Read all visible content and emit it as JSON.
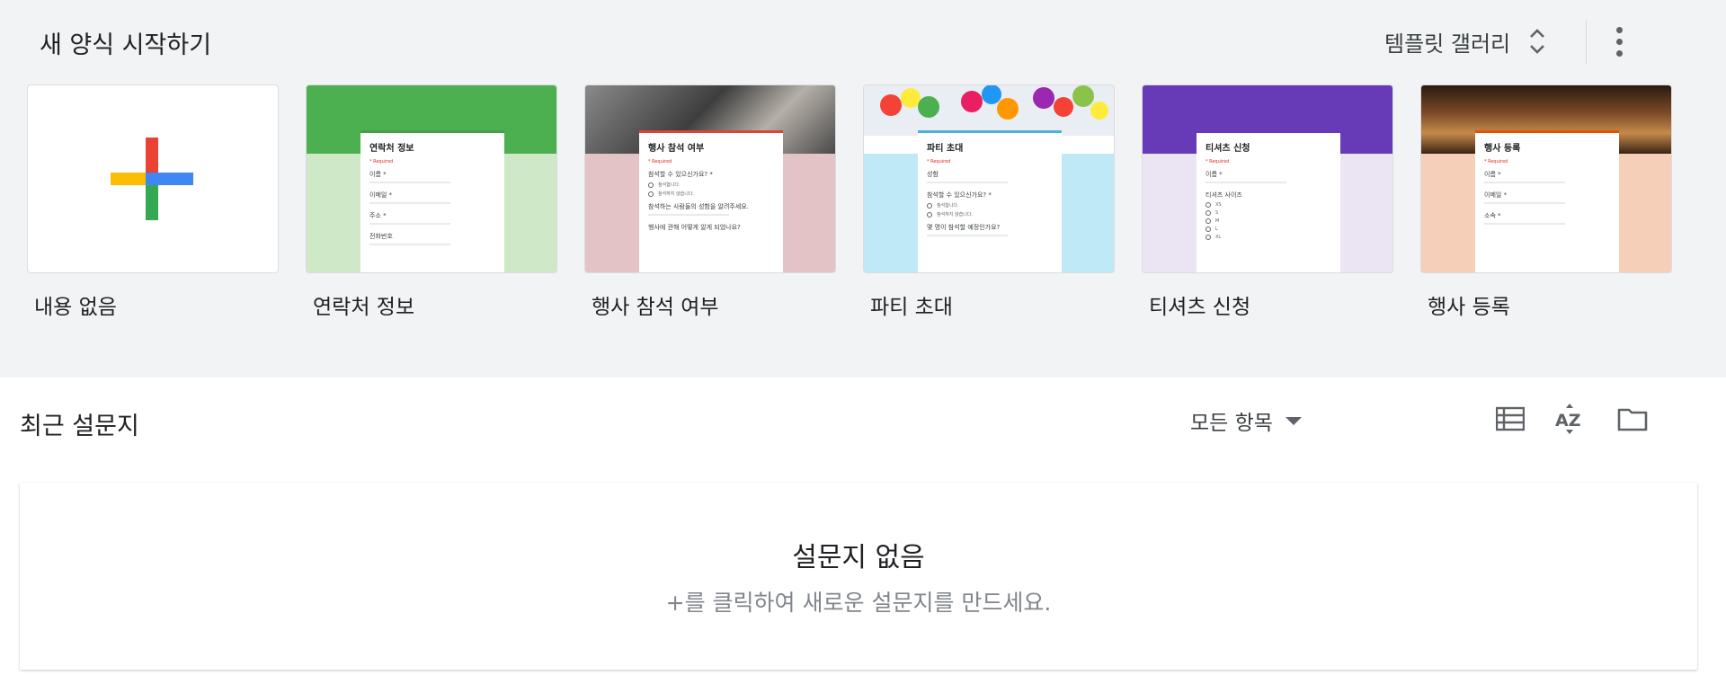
{
  "header": {
    "title": "새 양식 시작하기",
    "gallery_label": "템플릿 갤러리",
    "more_icon": "more-vert-icon",
    "gallery_icon": "unfold-more-icon"
  },
  "templates": [
    {
      "label": "내용 없음",
      "kind": "blank"
    },
    {
      "label": "연락처 정보",
      "form_title": "연락처 정보",
      "fields": [
        "이름 *",
        "이메일 *",
        "주소 *",
        "전화번호"
      ],
      "colors": {
        "banner": "#4caf50",
        "bg": "#cfe8c8",
        "accent": "#43a047"
      }
    },
    {
      "label": "행사 참석 여부",
      "form_title": "행사 참석 여부",
      "fields": [
        "참석할 수 있으신가요? *",
        "참석하는 사람들의 성함을 알려주세요.",
        "행사에 관해 어떻게 알게 되었나요?"
      ],
      "options": [
        "참석합니다.",
        "참석하지 않습니다."
      ],
      "colors": {
        "banner": "#6d6d6d",
        "bg": "#e3c3c6",
        "accent": "#db4437"
      }
    },
    {
      "label": "파티 초대",
      "form_title": "파티 초대",
      "fields": [
        "성함",
        "참석할 수 있으신가요? *",
        "몇 명이 참석할 예정인가요?"
      ],
      "options": [
        "참석합니다.",
        "참석하지 않습니다."
      ],
      "colors": {
        "banner": "#e8eef3",
        "bg": "#bfe9f7",
        "accent": "#4fb0d9"
      }
    },
    {
      "label": "티셔츠 신청",
      "form_title": "티셔츠 신청",
      "fields": [
        "이름 *",
        "티셔츠 사이즈"
      ],
      "options": [
        "XS",
        "S",
        "M",
        "L",
        "XL"
      ],
      "colors": {
        "banner": "#673ab7",
        "bg": "#ebe4f2",
        "accent": "#673ab7"
      }
    },
    {
      "label": "행사 등록",
      "form_title": "행사 등록",
      "fields": [
        "이름 *",
        "이메일 *",
        "소속 *"
      ],
      "colors": {
        "banner": "#5a3a22",
        "bg": "#f6cfb8",
        "accent": "#e65100"
      }
    }
  ],
  "recent": {
    "title": "최근 설문지",
    "filter_label": "모든 항목",
    "icons": [
      "list-view-icon",
      "sort-az-icon",
      "folder-icon"
    ],
    "empty_title": "설문지 없음",
    "empty_subtitle": "+를 클릭하여 새로운 설문지를 만드세요."
  },
  "colors": {
    "top_bg": "#f1f3f4",
    "plus_red": "#ea4335",
    "plus_blue": "#4285f4",
    "plus_yellow": "#fbbc04",
    "plus_green": "#34a853"
  }
}
